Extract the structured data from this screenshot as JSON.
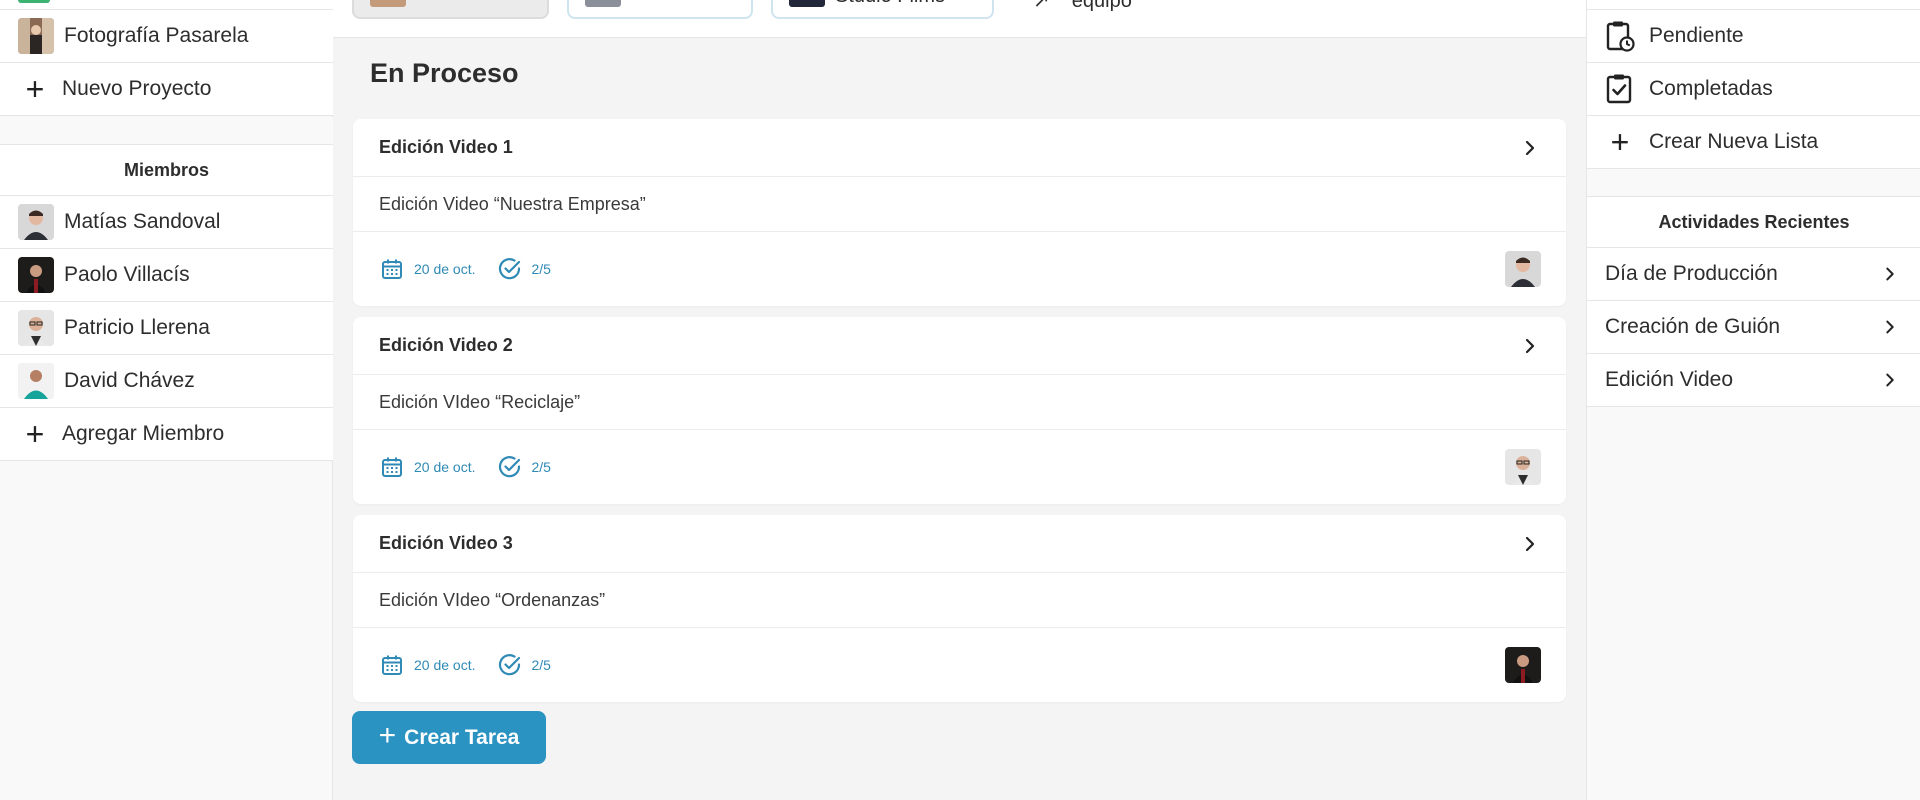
{
  "sidebar": {
    "projects": [
      {
        "label": "Fotografía Pasarela",
        "avatar": "runway-photo-avatar"
      }
    ],
    "new_project_label": "Nuevo Proyecto",
    "members_title": "Miembros",
    "members": [
      {
        "name": "Matías Sandoval"
      },
      {
        "name": "Paolo Villacís"
      },
      {
        "name": "Patricio Llerena"
      },
      {
        "name": "David Chávez"
      }
    ],
    "add_member_label": "Agregar Miembro"
  },
  "topbar": {
    "chips": [
      {
        "label": ""
      },
      {
        "label": ""
      },
      {
        "label": "Studio Films"
      }
    ],
    "team_label": "equipo"
  },
  "main": {
    "section_title": "En Proceso",
    "tasks": [
      {
        "title": "Edición Video 1",
        "description": "Edición Video “Nuestra Empresa”",
        "date": "20 de oct.",
        "progress": "2/5"
      },
      {
        "title": "Edición Video 2",
        "description": "Edición VIdeo “Reciclaje”",
        "date": "20 de oct.",
        "progress": "2/5"
      },
      {
        "title": "Edición Video 3",
        "description": "Edición VIdeo “Ordenanzas”",
        "date": "20 de oct.",
        "progress": "2/5"
      }
    ],
    "create_task_label": "Crear Tarea"
  },
  "right_sidebar": {
    "lists": [
      {
        "label": "Pendiente",
        "icon": "clipboard-clock-icon"
      },
      {
        "label": "Completadas",
        "icon": "clipboard-check-icon"
      }
    ],
    "create_list_label": "Crear Nueva Lista",
    "activities_title": "Actividades Recientes",
    "activities": [
      {
        "label": "Día de Producción"
      },
      {
        "label": "Creación de Guión"
      },
      {
        "label": "Edición Video"
      }
    ]
  },
  "colors": {
    "accent": "#2a93c2",
    "meta_text": "#2f8ab5",
    "background": "#f4f4f4"
  }
}
